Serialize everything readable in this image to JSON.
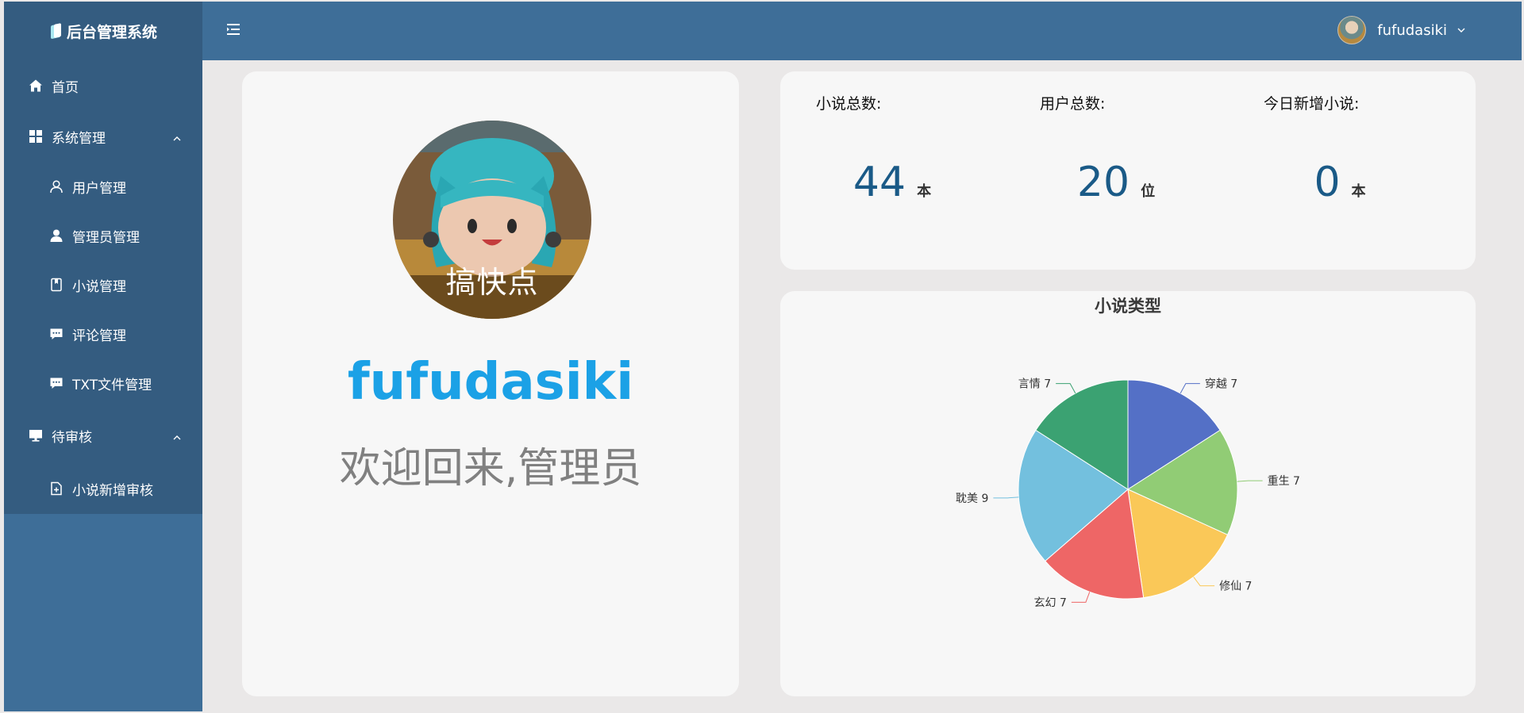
{
  "app": {
    "title": "后台管理系统"
  },
  "sidebar": {
    "items": [
      {
        "label": "首页",
        "icon": "home-icon"
      },
      {
        "label": "系统管理",
        "icon": "grid-icon",
        "expanded": true
      },
      {
        "label": "用户管理",
        "icon": "user-outline-icon"
      },
      {
        "label": "管理员管理",
        "icon": "user-filled-icon"
      },
      {
        "label": "小说管理",
        "icon": "book-icon"
      },
      {
        "label": "评论管理",
        "icon": "comment-icon"
      },
      {
        "label": "TXT文件管理",
        "icon": "comment-icon"
      },
      {
        "label": "待审核",
        "icon": "monitor-icon",
        "expanded": true
      },
      {
        "label": "小说新增审核",
        "icon": "file-add-icon"
      }
    ]
  },
  "header": {
    "username": "fufudasiki",
    "menu_icon": "hamburger-icon"
  },
  "profile": {
    "avatar_caption": "搞快点",
    "name": "fufudasiki",
    "welcome": "欢迎回来,管理员"
  },
  "stats": [
    {
      "label": "小说总数:",
      "value": "44",
      "unit": "本"
    },
    {
      "label": "用户总数:",
      "value": "20",
      "unit": "位"
    },
    {
      "label": "今日新增小说:",
      "value": "0",
      "unit": "本"
    }
  ],
  "chart_data": {
    "type": "pie",
    "title": "小说类型",
    "slices": [
      {
        "name": "穿越",
        "value": 7,
        "color": "#5470c6"
      },
      {
        "name": "重生",
        "value": 7,
        "color": "#91cc75"
      },
      {
        "name": "修仙",
        "value": 7,
        "color": "#fac858"
      },
      {
        "name": "玄幻",
        "value": 7,
        "color": "#ee6666"
      },
      {
        "name": "耽美",
        "value": 9,
        "color": "#73c0de"
      },
      {
        "name": "言情",
        "value": 7,
        "color": "#3ba272"
      }
    ]
  },
  "colors": {
    "sidebar": "#3e6e98",
    "sidebar_active": "#345c80",
    "accent": "#1ba1e6",
    "stat_number": "#1a5a87"
  }
}
